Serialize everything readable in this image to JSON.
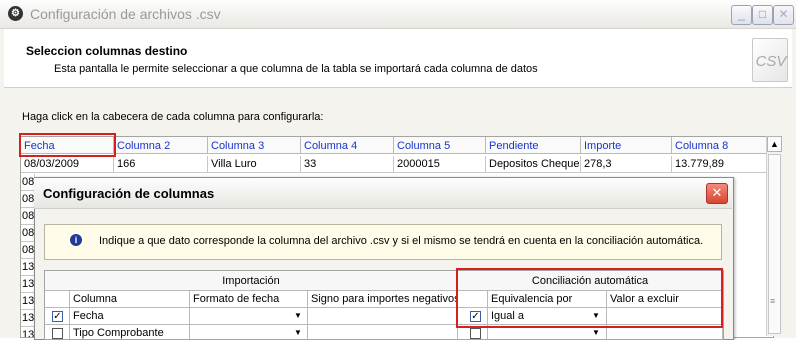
{
  "window": {
    "title": "Configuración de archivos .csv",
    "header_title": "Seleccion columnas destino",
    "header_subtitle": "Esta pantalla le permite seleccionar a que columna de la tabla se importará cada columna de datos",
    "doc_icon_label": "CSV",
    "hint": "Haga click en la cabecera de cada columna para configurarla:"
  },
  "grid": {
    "headers": [
      "Fecha",
      "Columna 2",
      "Columna 3",
      "Columna 4",
      "Columna 5",
      "Pendiente",
      "Importe",
      "Columna 8"
    ],
    "row1": [
      "08/03/2009",
      "166",
      "Villa Luro",
      "33",
      "2000015",
      "Depositos Cheque:",
      "278,3",
      "13.779,89"
    ],
    "partial_rows": [
      "08",
      "08",
      "08",
      "08",
      "08",
      "13",
      "13",
      "13",
      "13",
      "13",
      "13"
    ]
  },
  "dialog": {
    "title": "Configuración de columnas",
    "info_text": "Indique a que dato corresponde la columna del archivo .csv y si el mismo se tendrá en cuenta en la conciliación automática.",
    "sections": {
      "import": "Importación",
      "reconcile": "Conciliación automática"
    },
    "columns": {
      "column": "Columna",
      "date_format": "Formato de  fecha",
      "sign": "Signo para importes negativos",
      "equivalence": "Equivalencia por",
      "exclude": "Valor a excluir"
    },
    "rows": [
      {
        "checked": true,
        "column": "Fecha",
        "date_format": "",
        "sign": "",
        "rec_checked": true,
        "equivalence": "Igual a",
        "exclude": ""
      },
      {
        "checked": false,
        "column": "Tipo Comprobante",
        "date_format": "",
        "sign": "",
        "rec_checked": false,
        "equivalence": "",
        "exclude": ""
      }
    ]
  },
  "colors": {
    "highlight": "#d52020",
    "link_header": "#1b34c8"
  }
}
